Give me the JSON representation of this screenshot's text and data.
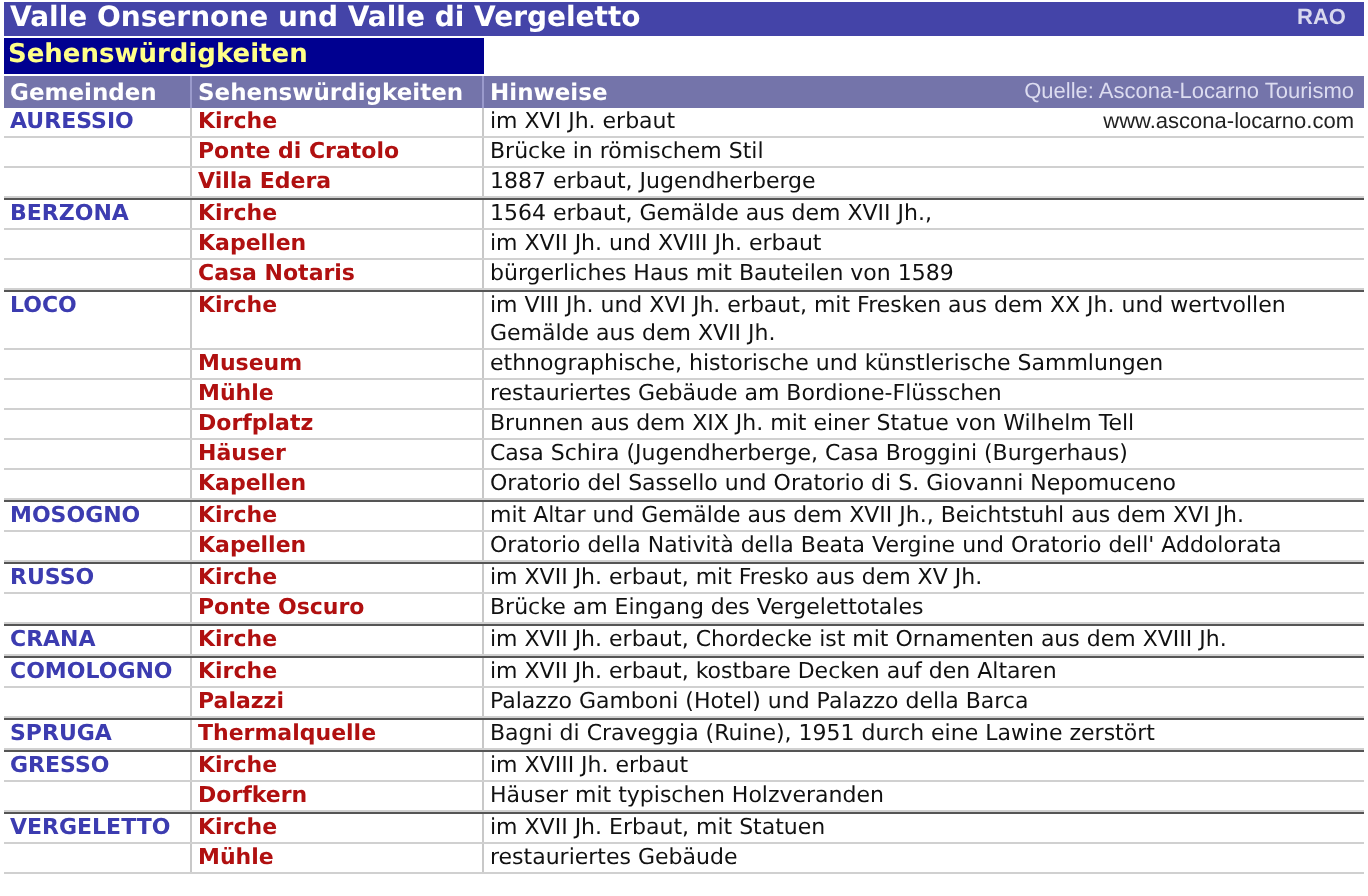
{
  "title": "Valle Onsernone und Valle di Vergeletto",
  "badge": "RAO",
  "section": "Sehenswürdigkeiten",
  "columns": [
    "Gemeinden",
    "Sehenswürdigkeiten",
    "Hinweise"
  ],
  "source": "Quelle: Ascona-Locarno Tourismo",
  "website": "www.ascona-locarno.com",
  "groups": [
    {
      "municipality": "AURESSIO",
      "items": [
        {
          "name": "Kirche",
          "note": "im XVI Jh. erbaut"
        },
        {
          "name": "Ponte di Cratolo",
          "note": "Brücke in römischem Stil"
        },
        {
          "name": "Villa Edera",
          "note": "1887 erbaut, Jugendherberge"
        }
      ]
    },
    {
      "municipality": "BERZONA",
      "items": [
        {
          "name": "Kirche",
          "note": "1564 erbaut, Gemälde aus dem XVII Jh.,"
        },
        {
          "name": "Kapellen",
          "note": "im XVII Jh. und XVIII Jh. erbaut"
        },
        {
          "name": "Casa Notaris",
          "note": "bürgerliches Haus mit Bauteilen von 1589"
        }
      ]
    },
    {
      "municipality": "LOCO",
      "items": [
        {
          "name": "Kirche",
          "note": "im VIII Jh. und XVI Jh. erbaut, mit Fresken aus dem XX Jh. und wertvollen Gemälde aus dem XVII Jh."
        },
        {
          "name": "Museum",
          "note": "ethnographische, historische und künstlerische Sammlungen"
        },
        {
          "name": "Mühle",
          "note": "restauriertes Gebäude am Bordione-Flüsschen"
        },
        {
          "name": "Dorfplatz",
          "note": "Brunnen aus dem XIX Jh. mit einer Statue von Wilhelm Tell"
        },
        {
          "name": "Häuser",
          "note": "Casa Schira (Jugendherberge, Casa Broggini (Burgerhaus)"
        },
        {
          "name": "Kapellen",
          "note": "Oratorio del Sassello und Oratorio di S. Giovanni Nepomuceno"
        }
      ]
    },
    {
      "municipality": "MOSOGNO",
      "items": [
        {
          "name": "Kirche",
          "note": "mit Altar und Gemälde aus dem XVII Jh., Beichtstuhl aus dem XVI Jh."
        },
        {
          "name": "Kapellen",
          "note": "Oratorio della Natività della Beata Vergine und Oratorio dell' Addolorata"
        }
      ]
    },
    {
      "municipality": "RUSSO",
      "items": [
        {
          "name": "Kirche",
          "note": "im XVII Jh. erbaut, mit Fresko aus dem XV Jh."
        },
        {
          "name": "Ponte Oscuro",
          "note": "Brücke am Eingang des Vergelettotales"
        }
      ]
    },
    {
      "municipality": "CRANA",
      "items": [
        {
          "name": "Kirche",
          "note": "im XVII Jh. erbaut, Chordecke ist mit Ornamenten aus dem XVIII Jh."
        }
      ]
    },
    {
      "municipality": "COMOLOGNO",
      "items": [
        {
          "name": "Kirche",
          "note": "im XVII Jh. erbaut, kostbare Decken auf den Altaren"
        },
        {
          "name": "Palazzi",
          "note": "Palazzo Gamboni (Hotel) und Palazzo della Barca"
        }
      ]
    },
    {
      "municipality": "SPRUGA",
      "items": [
        {
          "name": "Thermalquelle",
          "note": "Bagni di Craveggia (Ruine), 1951 durch eine Lawine zerstört"
        }
      ]
    },
    {
      "municipality": "GRESSO",
      "items": [
        {
          "name": "Kirche",
          "note": "im XVIII Jh. erbaut"
        },
        {
          "name": "Dorfkern",
          "note": "Häuser mit typischen Holzveranden"
        }
      ]
    },
    {
      "municipality": "VERGELETTO",
      "items": [
        {
          "name": "Kirche",
          "note": "im XVII Jh. Erbaut, mit Statuen"
        },
        {
          "name": "Mühle",
          "note": "restauriertes Gebäude"
        }
      ]
    }
  ]
}
